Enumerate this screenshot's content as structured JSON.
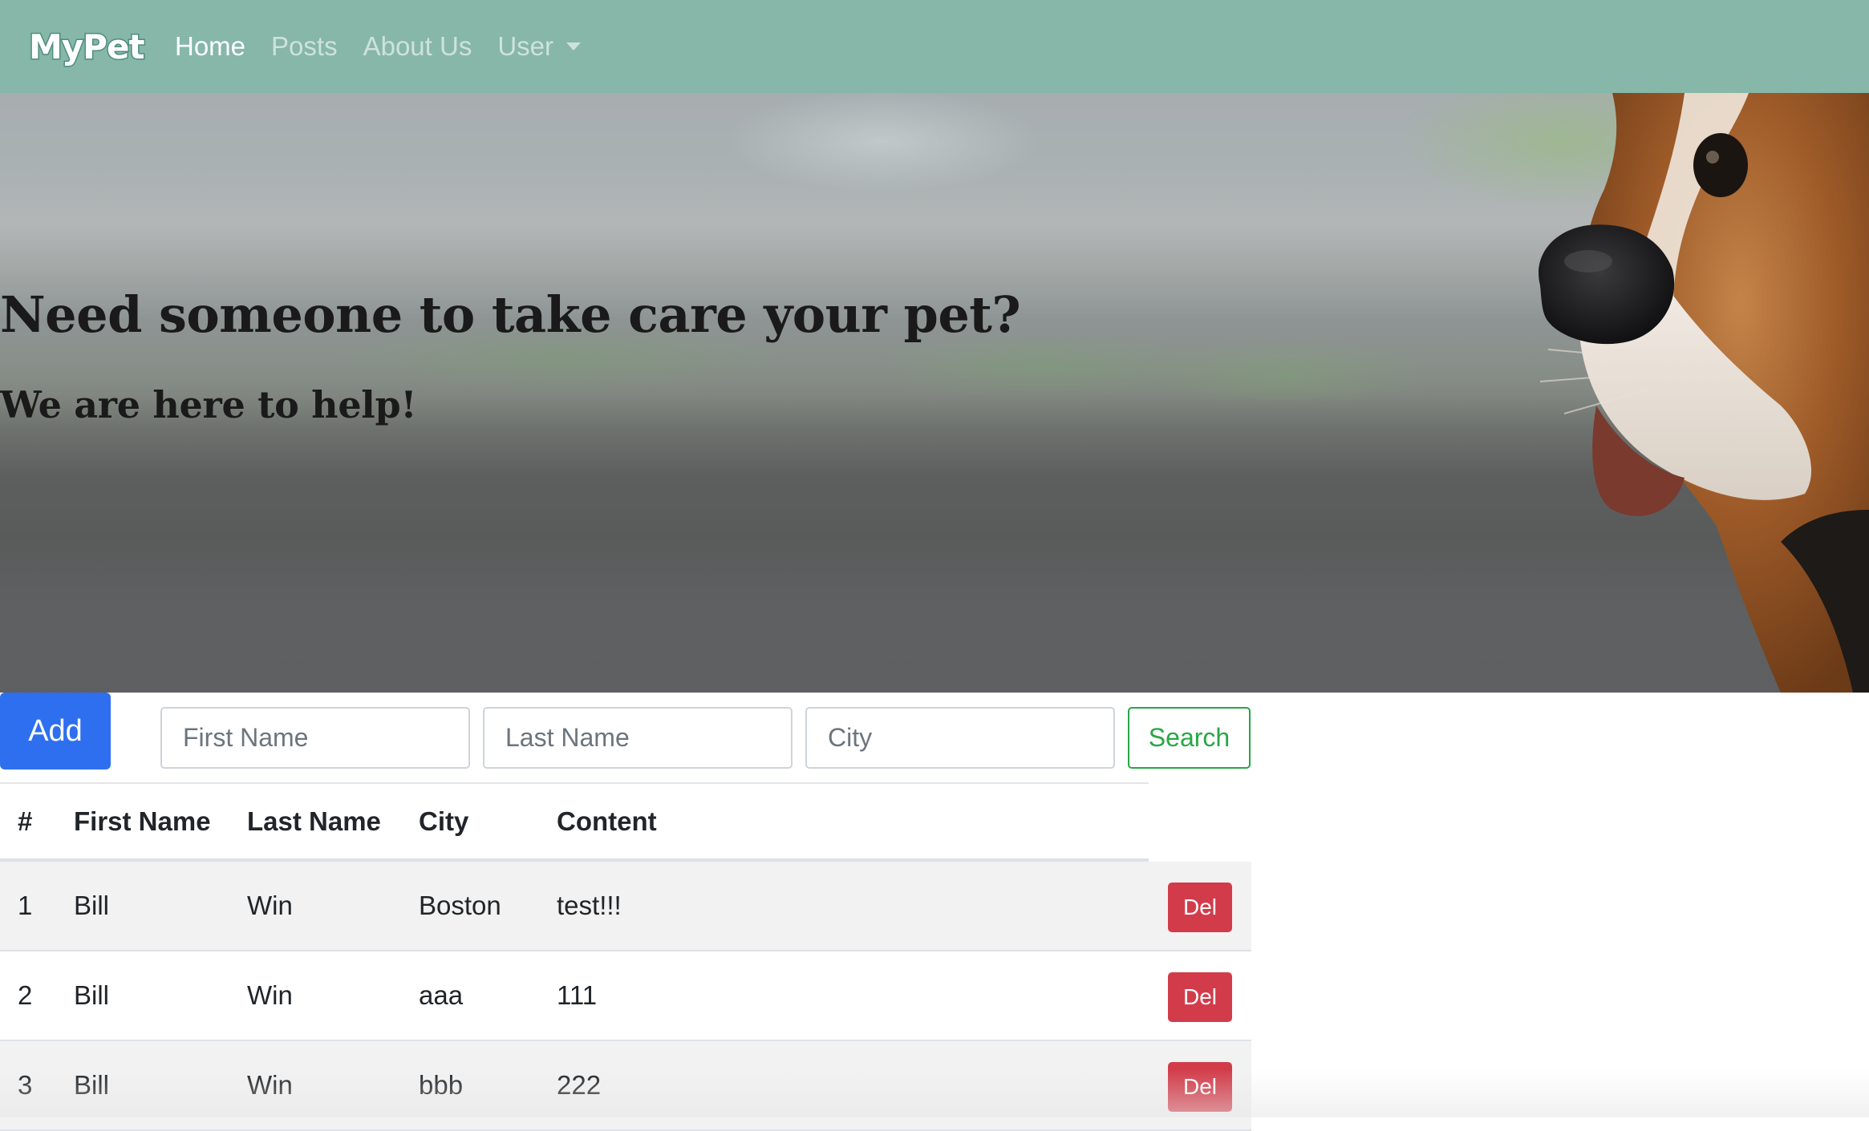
{
  "navbar": {
    "brand": "MyPet",
    "links": [
      {
        "label": "Home",
        "active": true
      },
      {
        "label": "Posts",
        "active": false
      },
      {
        "label": "About Us",
        "active": false
      },
      {
        "label": "User",
        "active": false,
        "dropdown": true
      }
    ]
  },
  "hero": {
    "title": "Need someone to take care your pet?",
    "subtitle": "We are here to help!"
  },
  "toolbar": {
    "add_label": "Add",
    "first_name_placeholder": "First Name",
    "last_name_placeholder": "Last Name",
    "city_placeholder": "City",
    "search_label": "Search"
  },
  "table": {
    "headers": [
      "#",
      "First Name",
      "Last Name",
      "City",
      "Content"
    ],
    "delete_label": "Del",
    "rows": [
      {
        "num": "1",
        "first": "Bill",
        "last": "Win",
        "city": "Boston",
        "content": "test!!!"
      },
      {
        "num": "2",
        "first": "Bill",
        "last": "Win",
        "city": "aaa",
        "content": "111"
      },
      {
        "num": "3",
        "first": "Bill",
        "last": "Win",
        "city": "bbb",
        "content": "222"
      }
    ]
  },
  "colors": {
    "navbar_bg": "#86b7a8",
    "primary": "#2e6ff0",
    "success": "#28a745",
    "danger": "#d23c4a"
  }
}
